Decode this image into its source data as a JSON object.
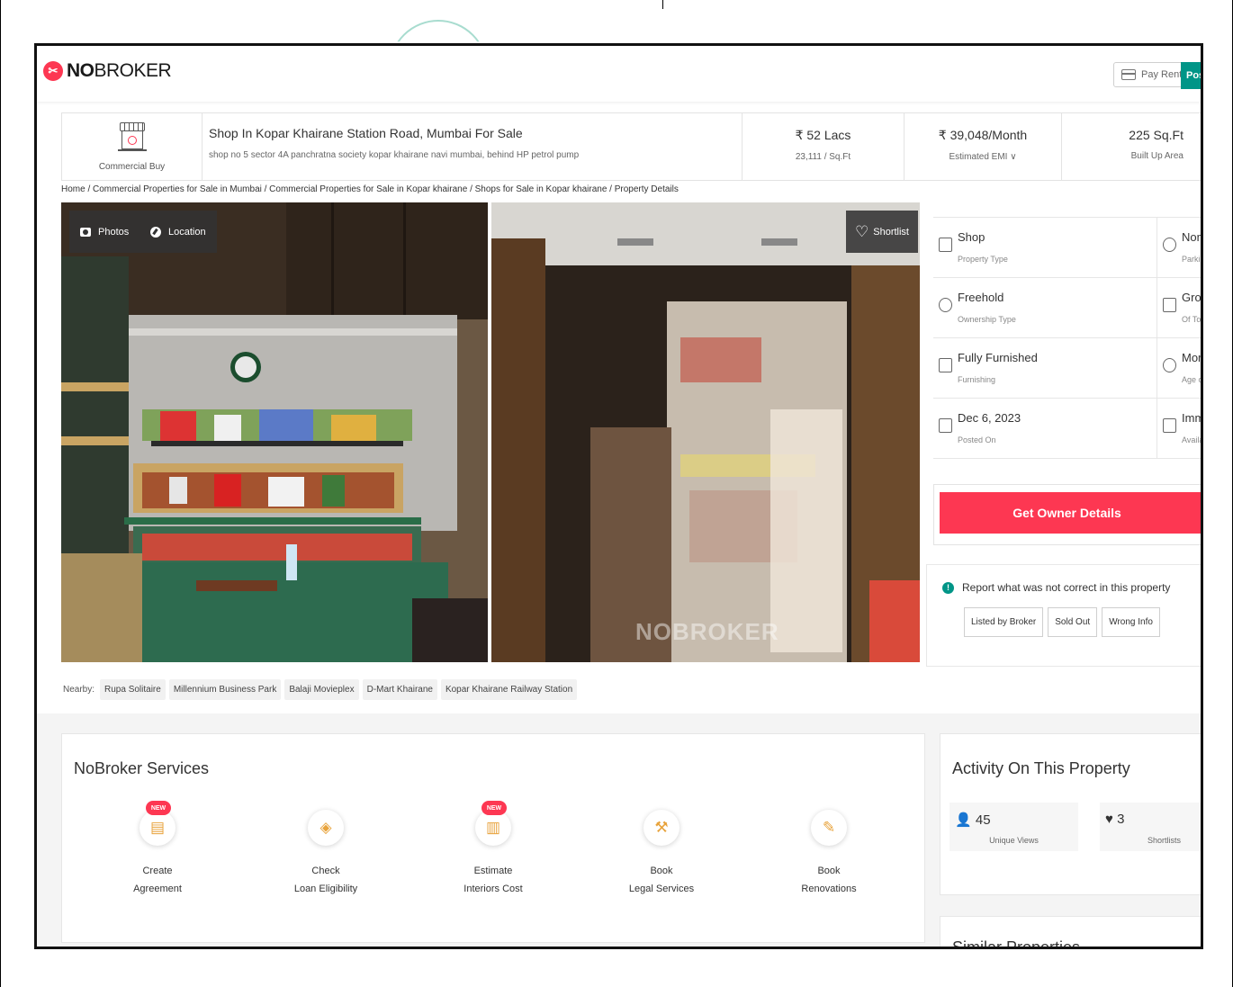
{
  "header": {
    "logo_bold": "NO",
    "logo_rest": "BROKER",
    "pay_rent": "Pay Rent",
    "post": "Post"
  },
  "summary": {
    "category": "Commercial Buy",
    "title": "Shop In Kopar Khairane Station Road, Mumbai For Sale",
    "address": "shop no 5 sector 4A panchratna society kopar khairane navi mumbai, behind HP petrol pump",
    "price": "₹ 52 Lacs",
    "price_per_sqft": "23,111 / Sq.Ft",
    "emi": "₹ 39,048/Month",
    "emi_label": "Estimated EMI ∨",
    "area": "225 Sq.Ft",
    "area_label": "Built Up Area"
  },
  "breadcrumb": "Home / Commercial Properties for Sale in Mumbai / Commercial Properties for Sale in Kopar khairane / Shops for Sale in Kopar khairane / Property Details",
  "photo_controls": {
    "photos": "Photos",
    "location": "Location",
    "shortlist": "Shortlist",
    "watermark": "NOBROKER"
  },
  "nearby": {
    "label": "Nearby:",
    "items": [
      "Rupa Solitaire",
      "Millennium Business Park",
      "Balaji Movieplex",
      "D-Mart Khairane",
      "Kopar Khairane Railway Station"
    ]
  },
  "details": [
    {
      "left_value": "Shop",
      "left_label": "Property Type",
      "right_value": "None",
      "right_label": "Parking"
    },
    {
      "left_value": "Freehold",
      "left_label": "Ownership Type",
      "right_value": "Grou",
      "right_label": "Of Tota"
    },
    {
      "left_value": "Fully Furnished",
      "left_label": "Furnishing",
      "right_value": "More",
      "right_label": "Age of"
    },
    {
      "left_value": "Dec 6, 2023",
      "left_label": "Posted On",
      "right_value": "Imm",
      "right_label": "Availab"
    }
  ],
  "owner_button": "Get Owner Details",
  "report": {
    "text": "Report what was not correct in this property",
    "tags": [
      "Listed by Broker",
      "Sold Out",
      "Wrong Info"
    ]
  },
  "services": {
    "title": "NoBroker Services",
    "new_badge": "NEW",
    "items": [
      {
        "line1": "Create",
        "line2": "Agreement"
      },
      {
        "line1": "Check",
        "line2": "Loan Eligibility"
      },
      {
        "line1": "Estimate",
        "line2": "Interiors Cost"
      },
      {
        "line1": "Book",
        "line2": "Legal Services"
      },
      {
        "line1": "Book",
        "line2": "Renovations"
      }
    ]
  },
  "activity": {
    "title": "Activity On This Property",
    "views": "45",
    "views_label": "Unique Views",
    "shortlists": "3",
    "shortlists_label": "Shortlists"
  },
  "similar": {
    "title": "Similar Properties"
  }
}
